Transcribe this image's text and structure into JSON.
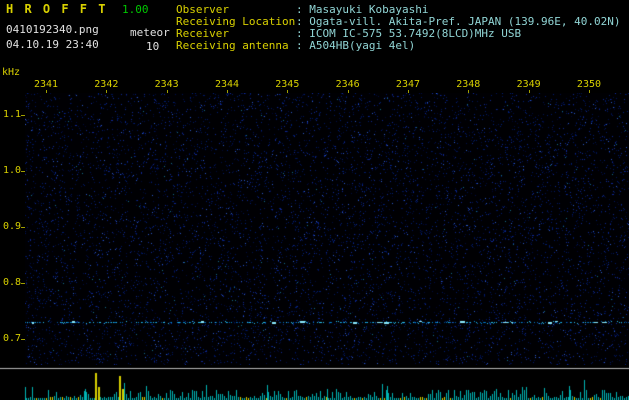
{
  "header": {
    "app_title": "H R O F F T",
    "app_version": "1.00",
    "file_name": "0410192340.png",
    "mode_label": "meteor",
    "timestamp": "04.10.19 23:40",
    "interval": "10",
    "info_rows": [
      {
        "label": "Observer",
        "value": "Masayuki Kobayashi"
      },
      {
        "label": "Receiving Location",
        "value": "Ogata-vill. Akita-Pref. JAPAN (139.96E, 40.02N)"
      },
      {
        "label": "Receiver",
        "value": "ICOM IC-575 53.7492(8LCD)MHz USB"
      },
      {
        "label": "Receiving antenna",
        "value": "A504HB(yagi 4el)"
      }
    ]
  },
  "chart_data": {
    "type": "heatmap",
    "subtype": "radio-meteor-spectrogram",
    "x_ticks": [
      "2341",
      "2342",
      "2343",
      "2344",
      "2345",
      "2346",
      "2347",
      "2348",
      "2349",
      "2350"
    ],
    "y_unit": "kHz",
    "y_ticks": [
      "1.1",
      "1.0",
      "0.9",
      "0.8",
      "0.7"
    ],
    "ylim": [
      0.65,
      1.14
    ],
    "carrier_band_khz": 0.73,
    "noise_floor": "sparse dark-blue speckle over black",
    "strip": {
      "divider_color": "#b8b8b8",
      "spike_color": "#00b4b4",
      "strong_color": "#d8d000",
      "strong_spikes": [
        {
          "x": 95,
          "h": 27
        },
        {
          "x": 98,
          "h": 13
        },
        {
          "x": 119,
          "h": 24
        },
        {
          "x": 122,
          "h": 11
        }
      ]
    }
  },
  "colors": {
    "background": "#000000",
    "axis_text": "#d8d000",
    "title_text": "#d8d000",
    "version_text": "#00c800",
    "file_text": "#e0e0e0",
    "label_text": "#d8d000",
    "value_text": "#90d4d4",
    "noise_blue": "#1830a0",
    "signal_cyan": "#40e0ff"
  }
}
